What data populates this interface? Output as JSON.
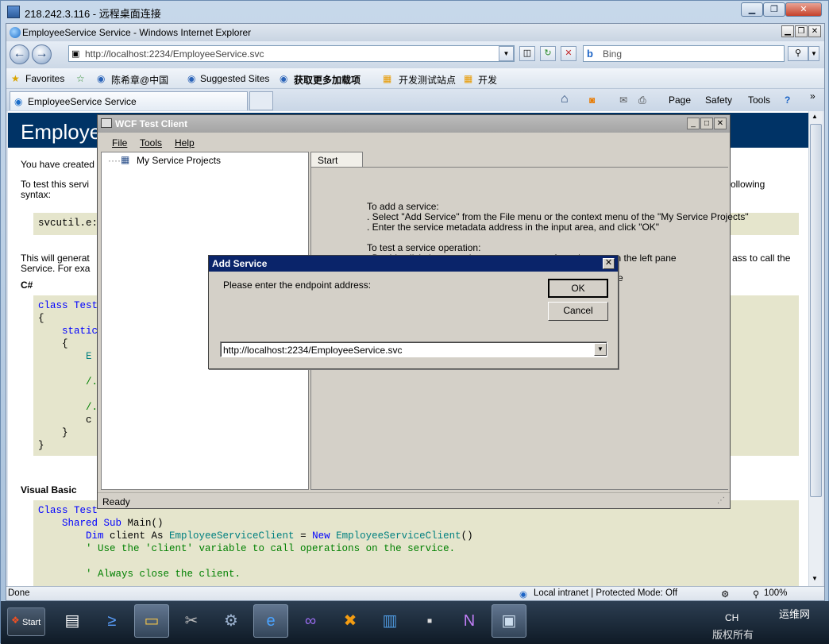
{
  "rdp": {
    "title": "218.242.3.116 - 远程桌面连接",
    "min": "▁",
    "restore": "❐",
    "close": "✕"
  },
  "ie": {
    "title": "EmployeeService Service - Windows Internet Explorer",
    "min": "▁",
    "max": "❐",
    "close": "✕",
    "address": "http://localhost:2234/EmployeeService.svc",
    "search_placeholder": "Bing",
    "favorites": [
      "Favorites",
      "陈希章@中国",
      "Suggested Sites",
      "获取更多加载项",
      "开发测试站点",
      "开发"
    ],
    "tab_title": "EmployeeService Service",
    "commands": [
      "Page",
      "Safety",
      "Tools"
    ],
    "status": {
      "left": "Done",
      "zone": "Local intranet | Protected Mode: Off",
      "zoom": "100%"
    }
  },
  "page": {
    "heading": "Employee",
    "line1": "You have created",
    "line2a": "To test this servi",
    "line2b": "ollowing",
    "line2c": "syntax:",
    "svcutil": "svcutil.e:",
    "line3a": "This will generat",
    "line3b": "ass to call the",
    "line3c": "Service. For exa",
    "csharp": "C#",
    "cs_code": [
      "class Test",
      "{",
      "    static",
      "    {",
      "        E",
      "",
      "        /.",
      "",
      "        /.",
      "        c",
      "    }",
      "}"
    ],
    "vb_label": "Visual Basic",
    "vb_code": {
      "l1": "Class Test",
      "l2_kw": "    Shared Sub",
      "l2_rest": " Main()",
      "l3_kw": "        Dim",
      "l3_a": " client As ",
      "l3_type": "EmployeeServiceClient",
      "l3_b": " = ",
      "l3_new": "New",
      "l3_type2": " EmployeeServiceClient",
      "l3_c": "()",
      "l4": "        ' Use the 'client' variable to call operations on the service.",
      "l5": "        ' Always close the client."
    }
  },
  "wcf": {
    "title": "WCF Test Client",
    "menu": [
      "File",
      "Tools",
      "Help"
    ],
    "tree_root": "My Service Projects",
    "tab": "Start Page",
    "instructions": [
      "To add a service:",
      ". Select \"Add Service\" from the File menu or the context menu of the \"My Service Projects\"",
      ". Enter the service metadata address in the input area, and click \"OK\"",
      "",
      "To test a service operation:",
      ". Double click the operation you want to test from the tree on the left pane",
      "e"
    ],
    "status": "Ready"
  },
  "dialog": {
    "title": "Add Service",
    "prompt": "Please enter the endpoint address:",
    "ok": "OK",
    "cancel": "Cancel",
    "value": "http://localhost:2234/EmployeeService.svc"
  },
  "taskbar": {
    "start": "Start",
    "lang": "CH",
    "watermark": "运维网",
    "watermark2": "版权所有"
  },
  "icons": [
    "back-icon",
    "forward-icon",
    "refresh-icon",
    "stop-icon",
    "search-icon",
    "home-icon",
    "rss-icon",
    "mail-icon",
    "print-icon",
    "help-icon"
  ]
}
